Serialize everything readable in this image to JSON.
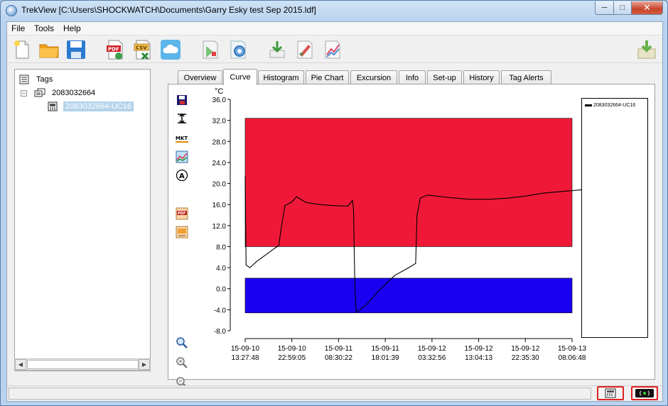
{
  "window": {
    "title": "TrekView [C:\\Users\\SHOCKWATCH\\Documents\\Garry Esky test Sep 2015.ldf]"
  },
  "menu": [
    {
      "label": "File"
    },
    {
      "label": "Tools"
    },
    {
      "label": "Help"
    }
  ],
  "toolbar": {
    "buttons": [
      "new-file-icon",
      "open-folder-icon",
      "save-icon",
      "export-pdf-icon",
      "export-csv-icon",
      "cloud-upload-icon",
      "read-device-icon",
      "configure-device-icon",
      "download-icon",
      "tag-edit-icon",
      "compare-curve-icon",
      "import-icon"
    ]
  },
  "tree": {
    "root": "Tags",
    "device": "2083032664",
    "tag": "2083032664-UC16"
  },
  "tabs": [
    {
      "label": "Overview"
    },
    {
      "label": "Curve"
    },
    {
      "label": "Histogram"
    },
    {
      "label": "Pie Chart"
    },
    {
      "label": "Excursion"
    },
    {
      "label": "Info"
    },
    {
      "label": "Set-up"
    },
    {
      "label": "History"
    },
    {
      "label": "Tag Alerts"
    }
  ],
  "active_tab": "Curve",
  "side_tools": [
    "save-chart-icon",
    "limits-icon",
    "mkt-icon",
    "chart-view-icon",
    "annotate-icon",
    "chart-pdf-icon",
    "chart-export-icon",
    "zoom-icon",
    "zoom-in-icon",
    "zoom-out-icon"
  ],
  "colors": {
    "high_band": "#f01838",
    "low_band": "#1a00f0",
    "line": "#000000",
    "selection": "#b4d3ea"
  },
  "chart_data": {
    "type": "line",
    "ylabel": "°C",
    "yticks": [
      "36.0",
      "32.0",
      "28.0",
      "24.0",
      "20.0",
      "16.0",
      "12.0",
      "8.0",
      "4.0",
      "0.0",
      "-4.0",
      "-8.0"
    ],
    "ylim": [
      -8.0,
      36.0
    ],
    "xticks": [
      {
        "date": "15-09-10",
        "time": "13:27:48"
      },
      {
        "date": "15-09-10",
        "time": "22:59:05"
      },
      {
        "date": "15-09-11",
        "time": "08:30:22"
      },
      {
        "date": "15-09-11",
        "time": "18:01:39"
      },
      {
        "date": "15-09-12",
        "time": "03:32:56"
      },
      {
        "date": "15-09-12",
        "time": "13:04:13"
      },
      {
        "date": "15-09-12",
        "time": "22:35:30"
      },
      {
        "date": "15-09-13",
        "time": "08:06:48"
      }
    ],
    "bands": [
      {
        "name": "high",
        "from": 8.0,
        "to": 32.4
      },
      {
        "name": "low",
        "from": -4.6,
        "to": 2.0
      }
    ],
    "series": [
      {
        "name": "2083032664-UC16",
        "points": [
          [
            0,
            21.5
          ],
          [
            0.02,
            4.5
          ],
          [
            0.1,
            4.0
          ],
          [
            0.25,
            5.2
          ],
          [
            0.45,
            6.5
          ],
          [
            0.6,
            7.5
          ],
          [
            0.72,
            8.2
          ],
          [
            0.78,
            12.0
          ],
          [
            0.85,
            15.8
          ],
          [
            1.0,
            16.5
          ],
          [
            1.1,
            17.5
          ],
          [
            1.3,
            16.4
          ],
          [
            1.6,
            16.0
          ],
          [
            1.9,
            15.8
          ],
          [
            2.2,
            15.7
          ],
          [
            2.3,
            16.8
          ],
          [
            2.32,
            15.0
          ],
          [
            2.35,
            0.0
          ],
          [
            2.38,
            -4.5
          ],
          [
            2.6,
            -3.0
          ],
          [
            2.9,
            0.0
          ],
          [
            3.2,
            2.5
          ],
          [
            3.5,
            4.0
          ],
          [
            3.65,
            4.8
          ],
          [
            3.68,
            14.0
          ],
          [
            3.75,
            17.2
          ],
          [
            3.9,
            17.8
          ],
          [
            4.1,
            17.6
          ],
          [
            4.4,
            17.3
          ],
          [
            4.8,
            17.0
          ],
          [
            5.2,
            17.0
          ],
          [
            5.6,
            17.2
          ],
          [
            6.0,
            17.6
          ],
          [
            6.4,
            18.2
          ],
          [
            6.8,
            18.5
          ],
          [
            7.2,
            18.8
          ],
          [
            7.5,
            18.6
          ],
          [
            7.8,
            18.8
          ],
          [
            7.95,
            19.5
          ],
          [
            7.98,
            20.5
          ],
          [
            8.0,
            20.0
          ]
        ]
      }
    ]
  }
}
